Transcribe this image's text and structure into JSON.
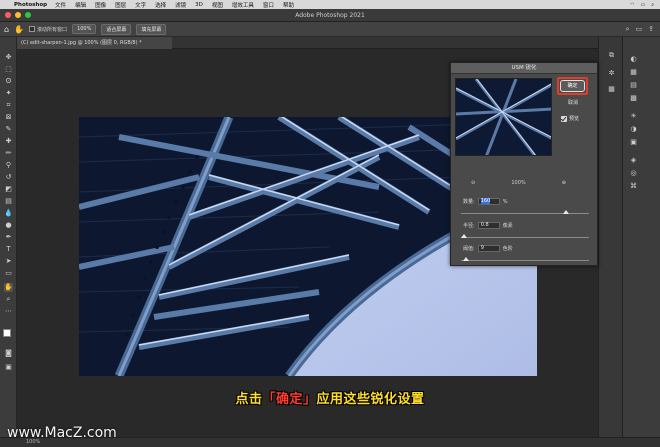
{
  "menubar": {
    "apple": "",
    "app": "Photoshop",
    "items": [
      "文件",
      "编辑",
      "图像",
      "图层",
      "文字",
      "选择",
      "滤镜",
      "3D",
      "视图",
      "增效工具",
      "窗口",
      "帮助"
    ]
  },
  "window": {
    "title": "Adobe Photoshop 2021"
  },
  "options": {
    "scroll_all": "滚动所有窗口",
    "zoom_value": "100%",
    "fit_screen": "适合屏幕",
    "fill_screen": "填充屏幕"
  },
  "document": {
    "tab": "(C) edit-sharpen-1.jpg @ 100% (图层 0, RGB/8) *"
  },
  "dialog": {
    "title": "USM 锐化",
    "ok": "确定",
    "cancel": "取消",
    "preview": "预览",
    "zoom": "100%",
    "zoom_out": "⊖",
    "zoom_in": "⊕",
    "amount_label": "数量:",
    "amount_value": "160",
    "amount_unit": "%",
    "amount_level": 0.82,
    "radius_label": "半径:",
    "radius_value": "0.8",
    "radius_unit": "像素",
    "radius_level": 0.02,
    "threshold_label": "阈值:",
    "threshold_value": "9",
    "threshold_unit": "色阶",
    "threshold_level": 0.04
  },
  "caption": {
    "pre": "点击",
    "highlight": "「确定」",
    "post": "应用这些锐化设置"
  },
  "status": {
    "zoom": "100%"
  },
  "watermark": {
    "brand": "www.MacZ.com"
  },
  "colors": {
    "highlight": "#e23c2c",
    "caption": "#ffde2a",
    "caption_red": "#ff3c2e",
    "sky": "#b9c6ec"
  }
}
